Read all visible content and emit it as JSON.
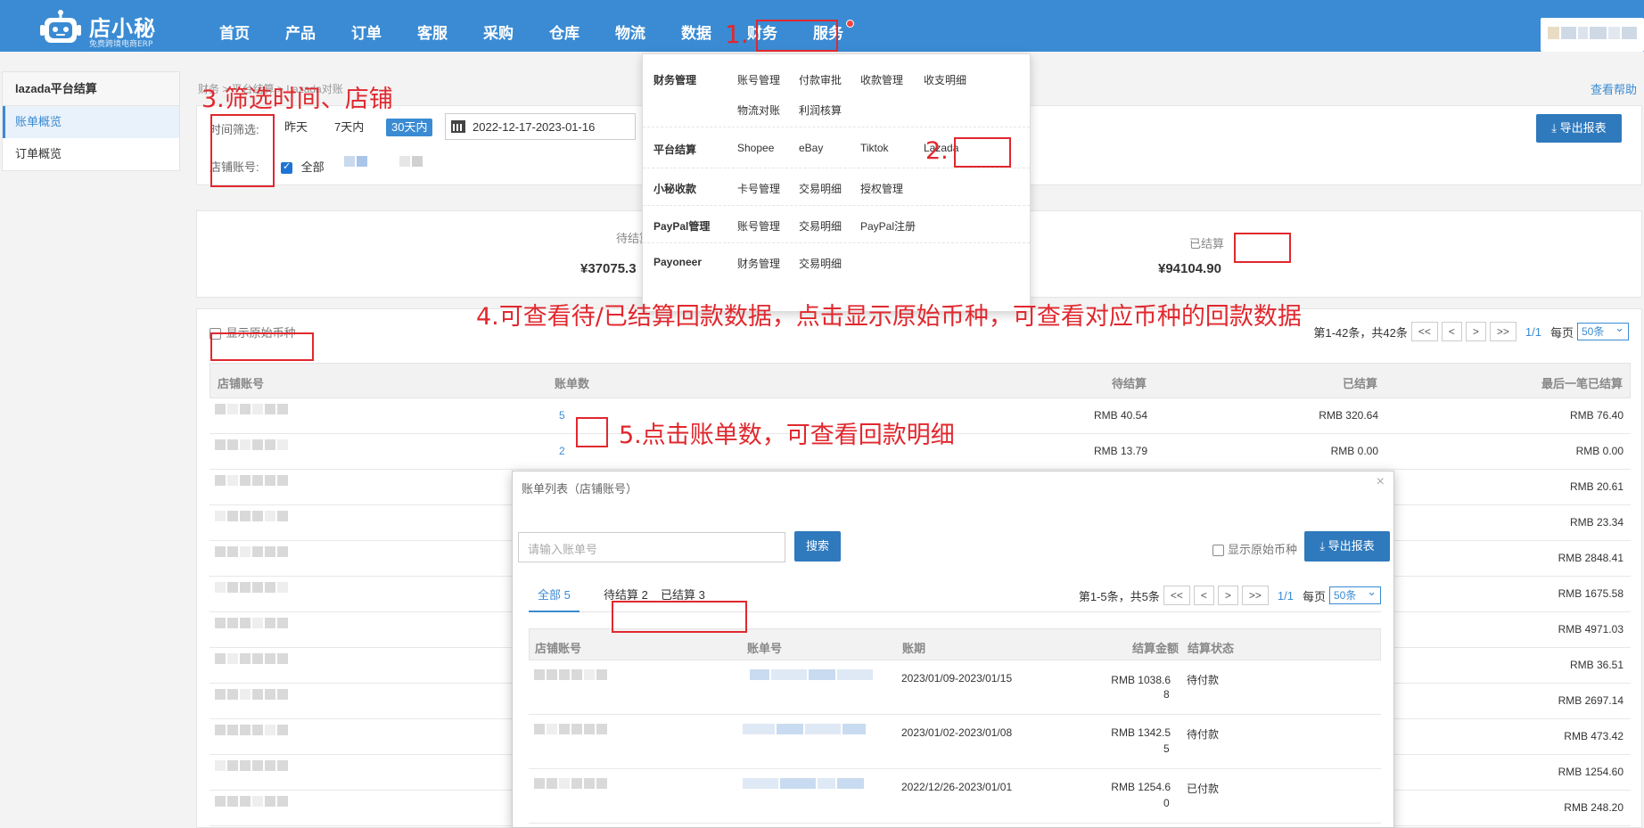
{
  "app": {
    "logo_title": "店小秘",
    "logo_sub": "免费跨境电商ERP"
  },
  "nav": [
    "首页",
    "产品",
    "订单",
    "客服",
    "采购",
    "仓库",
    "物流",
    "数据",
    "财务",
    "服务"
  ],
  "sidebar": {
    "title": "lazada平台结算",
    "items": [
      "账单概览",
      "订单概览"
    ]
  },
  "breadcrumb": "财务 > 平台结算 > Lazada对账",
  "help_link": "查看帮助",
  "filter": {
    "time_label": "时间筛选:",
    "options": [
      "昨天",
      "7天内",
      "30天内"
    ],
    "date_range": "2022-12-17-2023-01-16",
    "shop_label": "店铺账号:",
    "all_label": "全部",
    "export_label": "导出报表"
  },
  "summary": {
    "pending_label": "待结算",
    "pending_value": "¥37075.3",
    "settled_label": "已结算",
    "settled_value": "¥94104.90"
  },
  "table": {
    "show_currency_label": "显示原始币种",
    "page_info": "第1-42条，共42条",
    "page_current": "1/1",
    "per_page_label": "每页",
    "per_page_value": "50条",
    "headers": [
      "店铺账号",
      "账单数",
      "待结算",
      "已结算",
      "最后一笔已结算"
    ],
    "rows": [
      {
        "bills": "5",
        "pending": "RMB 40.54",
        "settled": "RMB 320.64",
        "last": "RMB 76.40"
      },
      {
        "bills": "2",
        "pending": "RMB 13.79",
        "settled": "RMB 0.00",
        "last": "RMB 0.00"
      },
      {
        "bills": "",
        "pending": "",
        "settled": "",
        "last": "RMB 20.61"
      },
      {
        "bills": "",
        "pending": "",
        "settled": "",
        "last": "RMB 23.34"
      },
      {
        "bills": "",
        "pending": "",
        "settled": "",
        "last": "RMB 2848.41"
      },
      {
        "bills": "",
        "pending": "",
        "settled": "",
        "last": "RMB 1675.58"
      },
      {
        "bills": "",
        "pending": "",
        "settled": "",
        "last": "RMB 4971.03"
      },
      {
        "bills": "",
        "pending": "",
        "settled": "",
        "last": "RMB 36.51"
      },
      {
        "bills": "",
        "pending": "",
        "settled": "",
        "last": "RMB 2697.14"
      },
      {
        "bills": "",
        "pending": "",
        "settled": "",
        "last": "RMB 473.42"
      },
      {
        "bills": "",
        "pending": "",
        "settled": "",
        "last": "RMB 1254.60"
      },
      {
        "bills": "",
        "pending": "",
        "settled": "",
        "last": "RMB 248.20"
      }
    ]
  },
  "dropdown": {
    "rows": [
      {
        "category": "财务管理",
        "links": [
          "账号管理",
          "付款审批",
          "收款管理",
          "收支明细",
          "物流对账",
          "利润核算"
        ]
      },
      {
        "category": "平台结算",
        "links": [
          "Shopee",
          "eBay",
          "Tiktok",
          "Lazada"
        ]
      },
      {
        "category": "小秘收款",
        "links": [
          "卡号管理",
          "交易明细",
          "授权管理"
        ]
      },
      {
        "category": "PayPal管理",
        "links": [
          "账号管理",
          "交易明细",
          "PayPal注册"
        ]
      },
      {
        "category": "Payoneer",
        "links": [
          "财务管理",
          "交易明细"
        ]
      }
    ]
  },
  "modal": {
    "title": "账单列表（店铺账号）",
    "search_placeholder": "请输入账单号",
    "search_label": "搜索",
    "show_currency_label": "显示原始币种",
    "export_label": "导出报表",
    "tabs": [
      "全部 5",
      "待结算 2",
      "已结算 3"
    ],
    "page_info": "第1-5条，共5条",
    "page_current": "1/1",
    "per_page_label": "每页",
    "per_page_value": "50条",
    "headers": [
      "店铺账号",
      "账单号",
      "账期",
      "结算金额",
      "结算状态"
    ],
    "rows": [
      {
        "period": "2023/01/09-2023/01/15",
        "amount_1": "RMB 1038.6",
        "amount_2": "8",
        "status": "待付款"
      },
      {
        "period": "2023/01/02-2023/01/08",
        "amount_1": "RMB 1342.5",
        "amount_2": "5",
        "status": "待付款"
      },
      {
        "period": "2022/12/26-2023/01/01",
        "amount_1": "RMB 1254.6",
        "amount_2": "0",
        "status": "已付款"
      }
    ]
  },
  "annotations": {
    "step1": "1.",
    "step2": "2.",
    "step3": "3.筛选时间、店铺",
    "step4": "4.可查看待/已结算回款数据，点击显示原始币种，可查看对应币种的回款数据",
    "step5": "5.点击账单数，可查看回款明细"
  },
  "colors": {
    "primary": "#3a8bd3",
    "annotation": "#e0282e"
  }
}
